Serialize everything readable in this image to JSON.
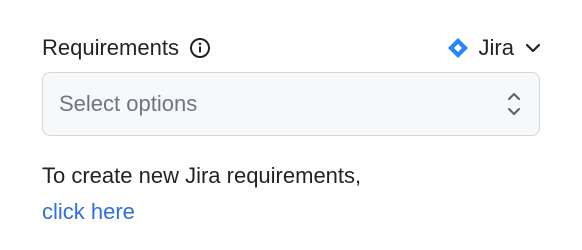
{
  "field": {
    "label": "Requirements",
    "info_icon": "info-icon",
    "source_icon": "jira-diamond-icon",
    "source_label": "Jira",
    "source_chevron": "chevron-down-icon"
  },
  "select": {
    "placeholder": "Select options",
    "icon": "updown-chevron-icon"
  },
  "helper": {
    "text": "To create new Jira requirements,",
    "link_label": "click here"
  },
  "colors": {
    "jira_blue": "#2684ff",
    "link": "#2f6fe0",
    "select_bg": "#f6f8fa",
    "border": "#d0d7de",
    "placeholder": "#6e7781"
  }
}
